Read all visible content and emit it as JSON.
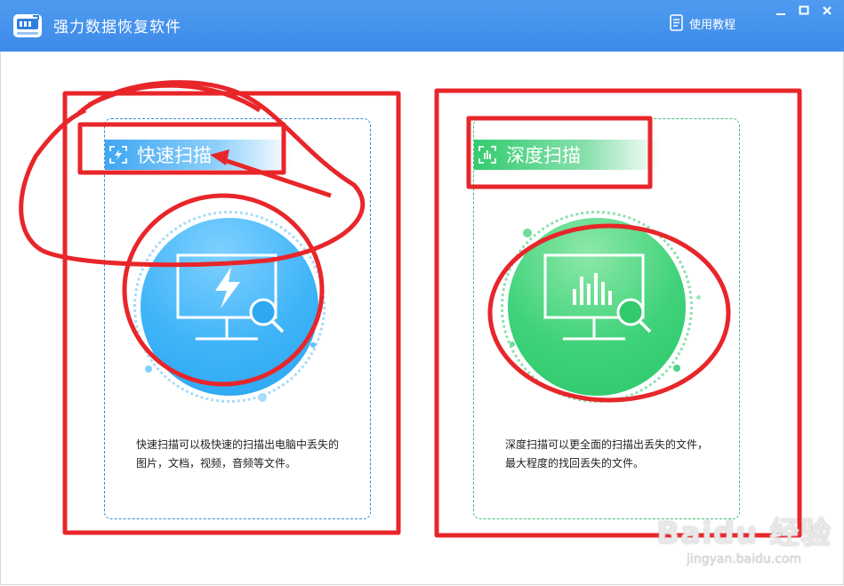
{
  "window": {
    "title": "强力数据恢复软件",
    "tutorial_label": "使用教程",
    "titlebar_color": "#4495ed"
  },
  "cards": [
    {
      "title": "快速扫描",
      "description": "快速扫描可以极快速的扫描出电脑中丢失的图片，文档，视频，音频等文件。",
      "accent": "#3fb4f8",
      "illustration_icon": "monitor-lightning-search-icon"
    },
    {
      "title": "深度扫描",
      "description": "深度扫描可以更全面的扫描出丢失的文件，最大程度的找回丢失的文件。",
      "accent": "#33cc6f",
      "illustration_icon": "monitor-bars-search-icon"
    }
  ],
  "watermark": {
    "main": "Baidu 经验",
    "sub": "jingyan.baidu.com"
  },
  "annotation_color": "#e8262a"
}
